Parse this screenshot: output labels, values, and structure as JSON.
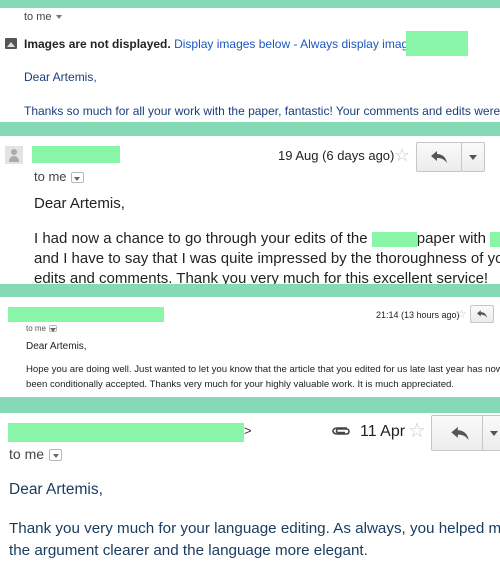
{
  "colors": {
    "band": "#86d9b5",
    "redaction": "#88f5a8",
    "link": "#1a57c0",
    "body_blue": "#1a3d7c"
  },
  "email1": {
    "to_me": "to me",
    "images_notice": "Images are not displayed.",
    "display_below": "Display images below",
    "separator": " - ",
    "always_display": "Always display images from",
    "greeting": "Dear Artemis,",
    "body": "Thanks so much for all your work with the paper, fantastic! Your comments and edits were super clear"
  },
  "email2": {
    "date": "19 Aug (6 days ago)",
    "to_me": "to me",
    "greeting": "Dear Artemis,",
    "line1_a": "I had now a chance to go through your edits of the ",
    "line1_b": "paper with ",
    "line2": "and I have to say that I was quite impressed by the thoroughness of your",
    "line3": "edits and comments. Thank you very much for this excellent service!"
  },
  "email3": {
    "date": "21:14 (13 hours ago)",
    "to_me": "to me",
    "greeting": "Dear Artemis,",
    "line1": "Hope you are doing well. Just wanted to let you know that the article that you edited for us late last year has now",
    "line2": "been conditionally accepted. Thanks very much for your highly valuable work. It is much appreciated."
  },
  "email4": {
    "sender_suffix": ">",
    "date": "11 Apr",
    "to_me": "to me",
    "greeting": "Dear Artemis,",
    "line1": "Thank you very much for your language editing. As always, you helped make",
    "line2": "the argument clearer and the language more elegant."
  },
  "icons": {
    "image": "image-icon",
    "star": "star-icon",
    "reply": "reply-icon",
    "more": "chevron-down-icon",
    "attachment": "paperclip-icon",
    "avatar": "avatar-icon"
  }
}
